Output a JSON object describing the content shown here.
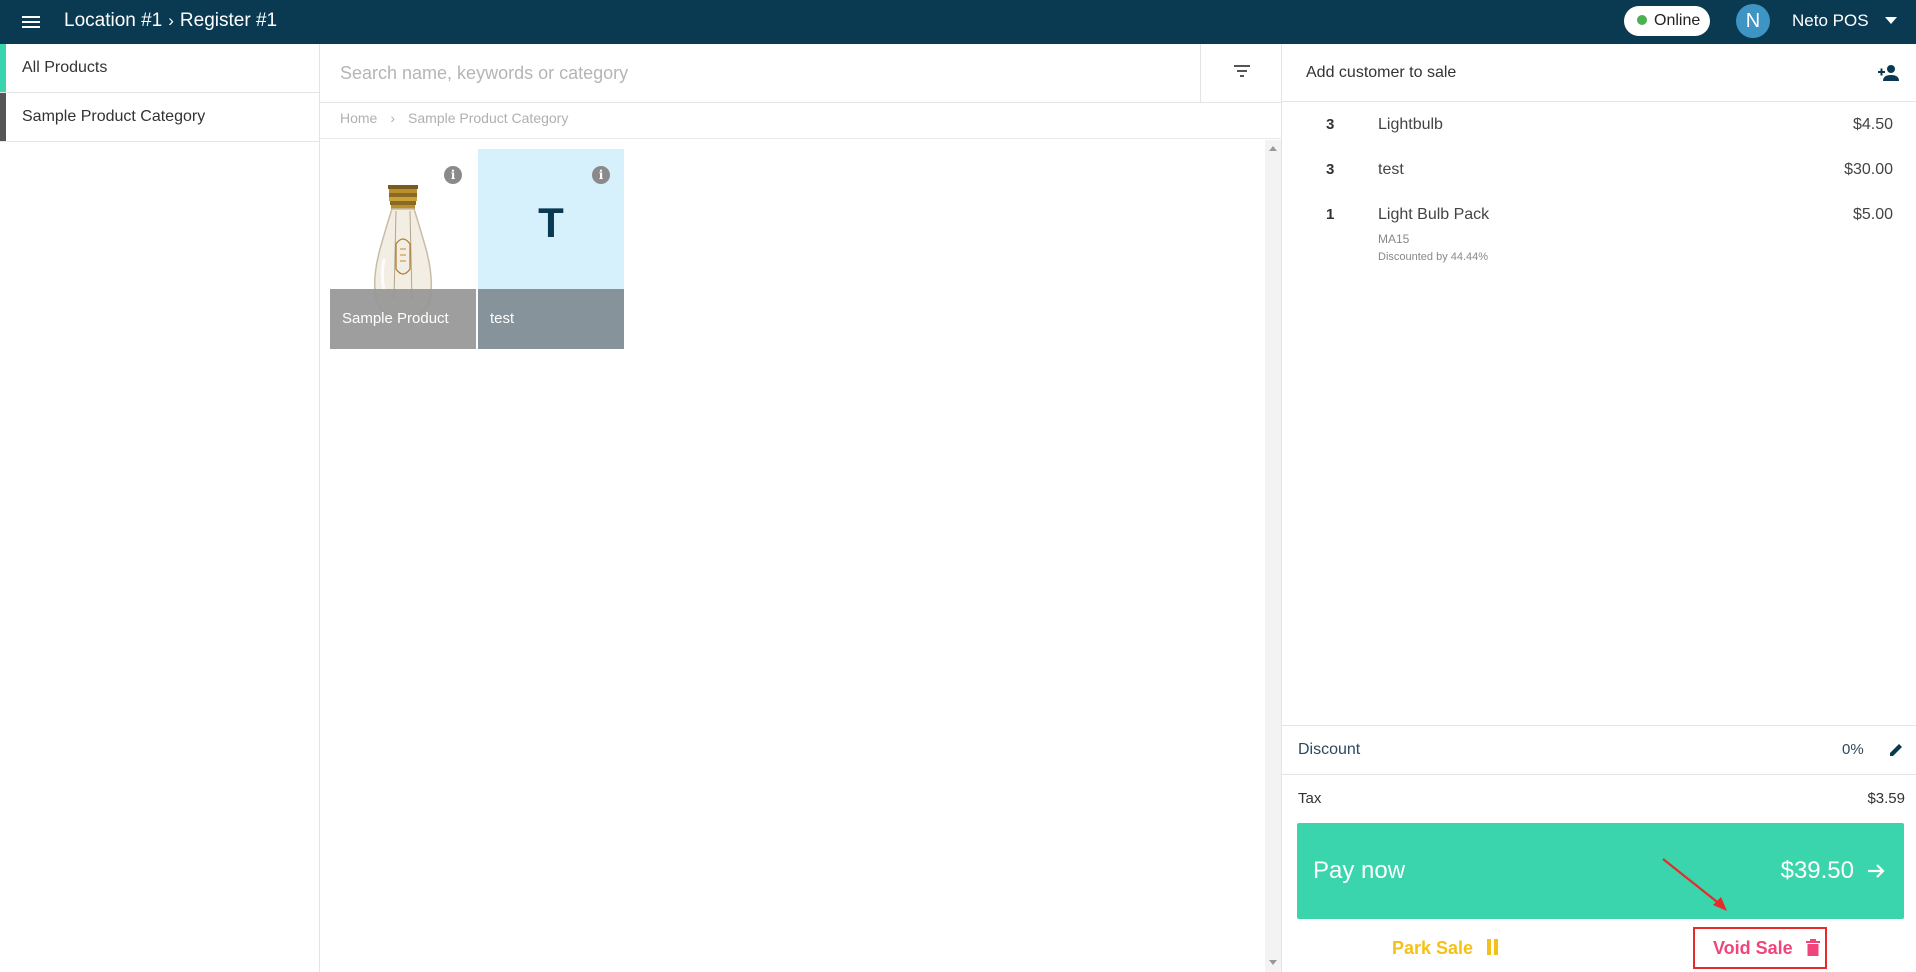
{
  "header": {
    "location": "Location #1",
    "separator": "›",
    "register": "Register #1",
    "status": "Online",
    "avatar_initial": "N",
    "user_name": "Neto POS",
    "bg_color": "#0a3a52"
  },
  "sidebar": {
    "items": [
      {
        "label": "All Products",
        "accent": "#3ad4ad"
      },
      {
        "label": "Sample Product Category",
        "accent": "#555555"
      }
    ]
  },
  "search": {
    "placeholder": "Search name, keywords or category",
    "value": ""
  },
  "breadcrumb": {
    "home": "Home",
    "separator": "›",
    "current": "Sample Product Category"
  },
  "products": [
    {
      "name": "Sample Product",
      "image": "lightbulb",
      "info_icon": "info-icon"
    },
    {
      "name": "test",
      "letter": "T",
      "info_icon": "info-icon"
    }
  ],
  "sale": {
    "add_customer_label": "Add customer to sale",
    "items": [
      {
        "qty": "3",
        "name": "Lightbulb",
        "price": "$4.50"
      },
      {
        "qty": "3",
        "name": "test",
        "price": "$30.00"
      },
      {
        "qty": "1",
        "name": "Light Bulb Pack",
        "price": "$5.00",
        "sku": "MA15",
        "note": "Discounted by 44.44%"
      }
    ],
    "discount_label": "Discount",
    "discount_value": "0%",
    "tax_label": "Tax",
    "tax_value": "$3.59",
    "pay_label": "Pay now",
    "pay_amount": "$39.50",
    "park_label": "Park Sale",
    "void_label": "Void Sale",
    "pay_color": "#3ad4ad",
    "park_color": "#f5c018",
    "void_color": "#f0457a"
  }
}
